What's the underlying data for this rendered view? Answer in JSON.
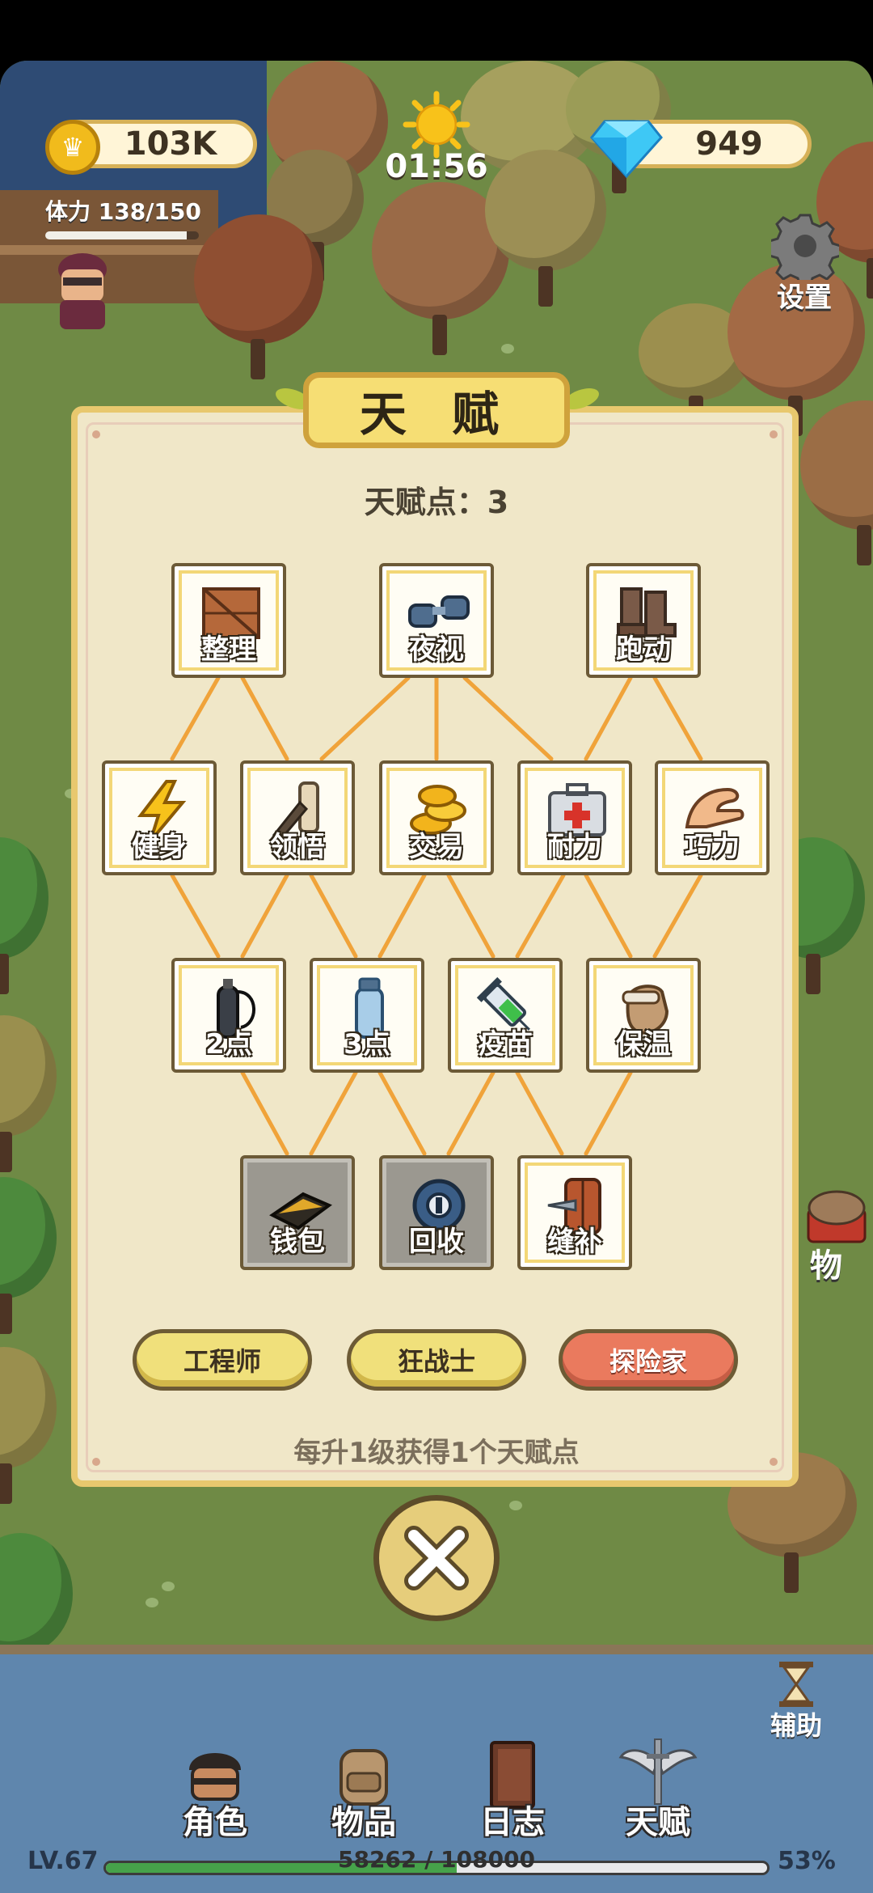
{
  "hud": {
    "coins": "103K",
    "timer": "01:56",
    "gems": "949",
    "stamina_label": "体力 138/150",
    "stamina_value": 138,
    "stamina_max": 150,
    "settings_label": "设置",
    "side_item_label": "物"
  },
  "talent_panel": {
    "title": "天 赋",
    "points_text": "天赋点：3",
    "nodes": [
      {
        "id": "zhengli",
        "label": "整理",
        "icon": "wooden-crate-icon",
        "locked": false
      },
      {
        "id": "yeshi",
        "label": "夜视",
        "icon": "binoculars-icon",
        "locked": false
      },
      {
        "id": "paodong",
        "label": "跑动",
        "icon": "boots-icon",
        "locked": false
      },
      {
        "id": "jianshen",
        "label": "健身",
        "icon": "lightning-icon",
        "locked": false
      },
      {
        "id": "lingwu",
        "label": "领悟",
        "icon": "scroll-quill-icon",
        "locked": false
      },
      {
        "id": "jiaoyi",
        "label": "交易",
        "icon": "gold-coins-icon",
        "locked": false
      },
      {
        "id": "naili",
        "label": "耐力",
        "icon": "first-aid-kit-icon",
        "locked": false
      },
      {
        "id": "qiaoli",
        "label": "巧力",
        "icon": "hand-icon",
        "locked": false
      },
      {
        "id": "2dian",
        "label": "2点",
        "icon": "oxygen-tank-icon",
        "locked": false
      },
      {
        "id": "3dian",
        "label": "3点",
        "icon": "water-bottle-icon",
        "locked": false
      },
      {
        "id": "yimiao",
        "label": "疫苗",
        "icon": "syringe-icon",
        "locked": false
      },
      {
        "id": "baowen",
        "label": "保温",
        "icon": "fur-glove-icon",
        "locked": false
      },
      {
        "id": "qianbao",
        "label": "钱包",
        "icon": "wallet-icon",
        "locked": true
      },
      {
        "id": "huishou",
        "label": "回收",
        "icon": "recycle-gear-icon",
        "locked": true
      },
      {
        "id": "fengbu",
        "label": "缝补",
        "icon": "shield-needle-icon",
        "locked": false
      }
    ],
    "classes": [
      {
        "label": "工程师",
        "active": false
      },
      {
        "label": "狂战士",
        "active": false
      },
      {
        "label": "探险家",
        "active": true
      }
    ],
    "hint": "每升1级获得1个天赋点"
  },
  "bottom_nav": {
    "assist_label": "辅助",
    "tabs": [
      {
        "label": "角色",
        "icon": "character-icon"
      },
      {
        "label": "物品",
        "icon": "backpack-icon"
      },
      {
        "label": "日志",
        "icon": "journal-icon"
      },
      {
        "label": "天赋",
        "icon": "winged-sword-icon"
      }
    ]
  },
  "xp": {
    "level": "LV.67",
    "progress_text": "58262 / 108000",
    "percent_text": "53%",
    "fraction": 0.53
  },
  "colors": {
    "panel_bg": "#f0e7c8",
    "panel_border": "#e8c86e",
    "connector": "#f0a33a",
    "active_class": "#ea7a5e",
    "class_button": "#f0e07b",
    "xp_fill": "#46a24a"
  }
}
